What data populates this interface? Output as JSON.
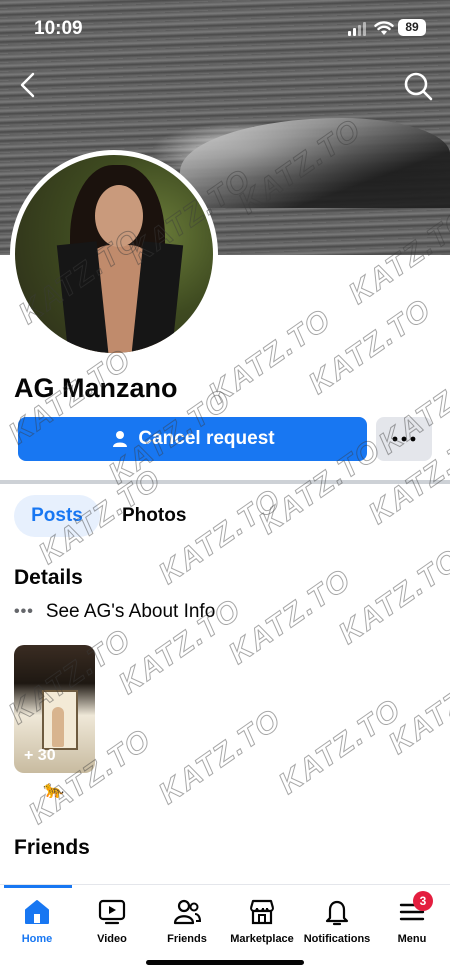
{
  "status_bar": {
    "time": "10:09",
    "battery": "89"
  },
  "profile": {
    "name": "AG Manzano"
  },
  "actions": {
    "cancel_request": "Cancel request",
    "more": "···"
  },
  "tabs": [
    {
      "label": "Posts",
      "active": true
    },
    {
      "label": "Photos",
      "active": false
    }
  ],
  "details": {
    "title": "Details",
    "about": "See AG's About Info",
    "about_dots": "•••"
  },
  "photos": {
    "count": "+ 30",
    "emoji": "🐆"
  },
  "friends": {
    "title": "Friends"
  },
  "bottom_nav": [
    {
      "label": "Home",
      "icon": "home-icon",
      "active": true
    },
    {
      "label": "Video",
      "icon": "video-icon"
    },
    {
      "label": "Friends",
      "icon": "friends-icon"
    },
    {
      "label": "Marketplace",
      "icon": "marketplace-icon"
    },
    {
      "label": "Notifications",
      "icon": "bell-icon"
    },
    {
      "label": "Menu",
      "icon": "menu-icon",
      "badge": "3"
    }
  ],
  "watermark": "KATZ.TO",
  "colors": {
    "accent": "#1877f2",
    "badge": "#e41e3f",
    "chip_bg": "#e7f0fd"
  }
}
